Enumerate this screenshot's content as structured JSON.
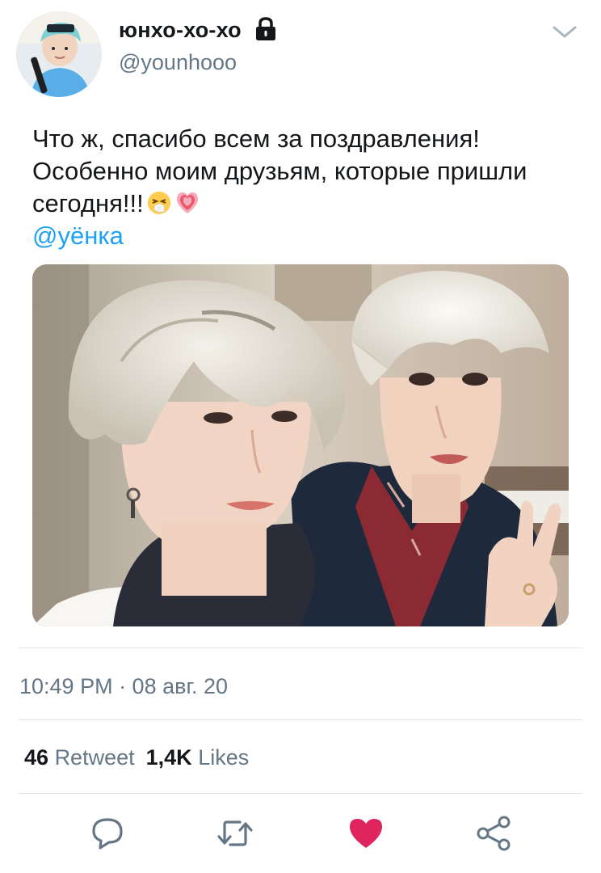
{
  "author": {
    "display_name": "юнхо-хо-хо",
    "handle": "@younhooo",
    "protected_icon": "lock-icon"
  },
  "tweet": {
    "text_line1": "Что ж, спасибо всем за поздравления!",
    "text_line2": "Особенно моим друзьям, которые пришли",
    "text_line3": "сегодня!!!",
    "emojis": [
      "sneezing-face-emoji",
      "growing-heart-emoji"
    ],
    "mention": "@уёнка",
    "timestamp": "10:49 PM · 08 авг. 20"
  },
  "stats": {
    "retweets_count": "46",
    "retweets_label": "Retweet",
    "likes_count": "1,4K",
    "likes_label": "Likes"
  },
  "actions": [
    "reply-icon",
    "retweet-icon",
    "like-icon",
    "share-icon"
  ],
  "colors": {
    "link": "#1da1f2",
    "secondary_text": "#657786",
    "icon": "#657786",
    "like_active": "#e0245e",
    "divider": "#e1e8ed"
  }
}
